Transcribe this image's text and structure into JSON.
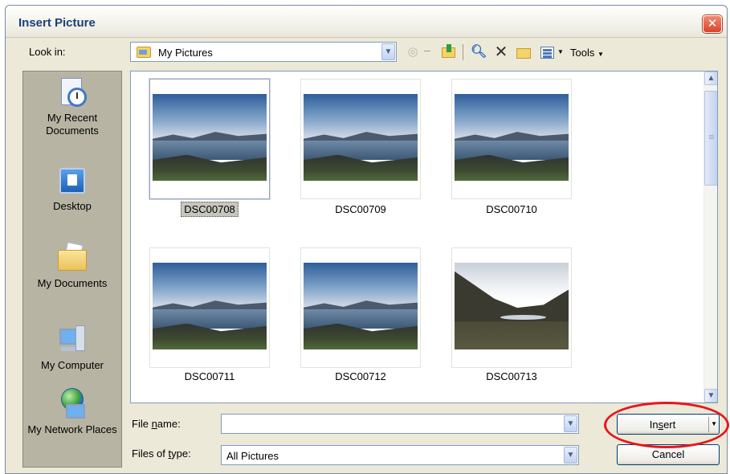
{
  "window": {
    "title": "Insert Picture"
  },
  "look_in": {
    "label": "Look in:",
    "value": "My Pictures"
  },
  "toolbar": {
    "tools_label": "Tools"
  },
  "places": [
    {
      "label": "My Recent Documents"
    },
    {
      "label": "Desktop"
    },
    {
      "label": "My Documents"
    },
    {
      "label": "My Computer"
    },
    {
      "label": "My Network Places"
    }
  ],
  "files": [
    {
      "name": "DSC00708",
      "selected": true
    },
    {
      "name": "DSC00709",
      "selected": false
    },
    {
      "name": "DSC00710",
      "selected": false
    },
    {
      "name": "DSC00711",
      "selected": false
    },
    {
      "name": "DSC00712",
      "selected": false
    },
    {
      "name": "DSC00713",
      "selected": false
    }
  ],
  "file_name": {
    "label_pre": "File ",
    "label_key": "n",
    "label_post": "ame:",
    "value": ""
  },
  "file_type": {
    "label_pre": "Files of ",
    "label_key": "t",
    "label_post": "ype:",
    "value": "All Pictures"
  },
  "buttons": {
    "insert_pre": "In",
    "insert_key": "s",
    "insert_post": "ert",
    "cancel": "Cancel"
  },
  "colors": {
    "title_text": "#1d3f7a",
    "close_button": "#d8452b",
    "annotation_circle": "#e5171c",
    "places_bar": "#b7b4a4",
    "dialog_bg": "#ece9d8"
  }
}
